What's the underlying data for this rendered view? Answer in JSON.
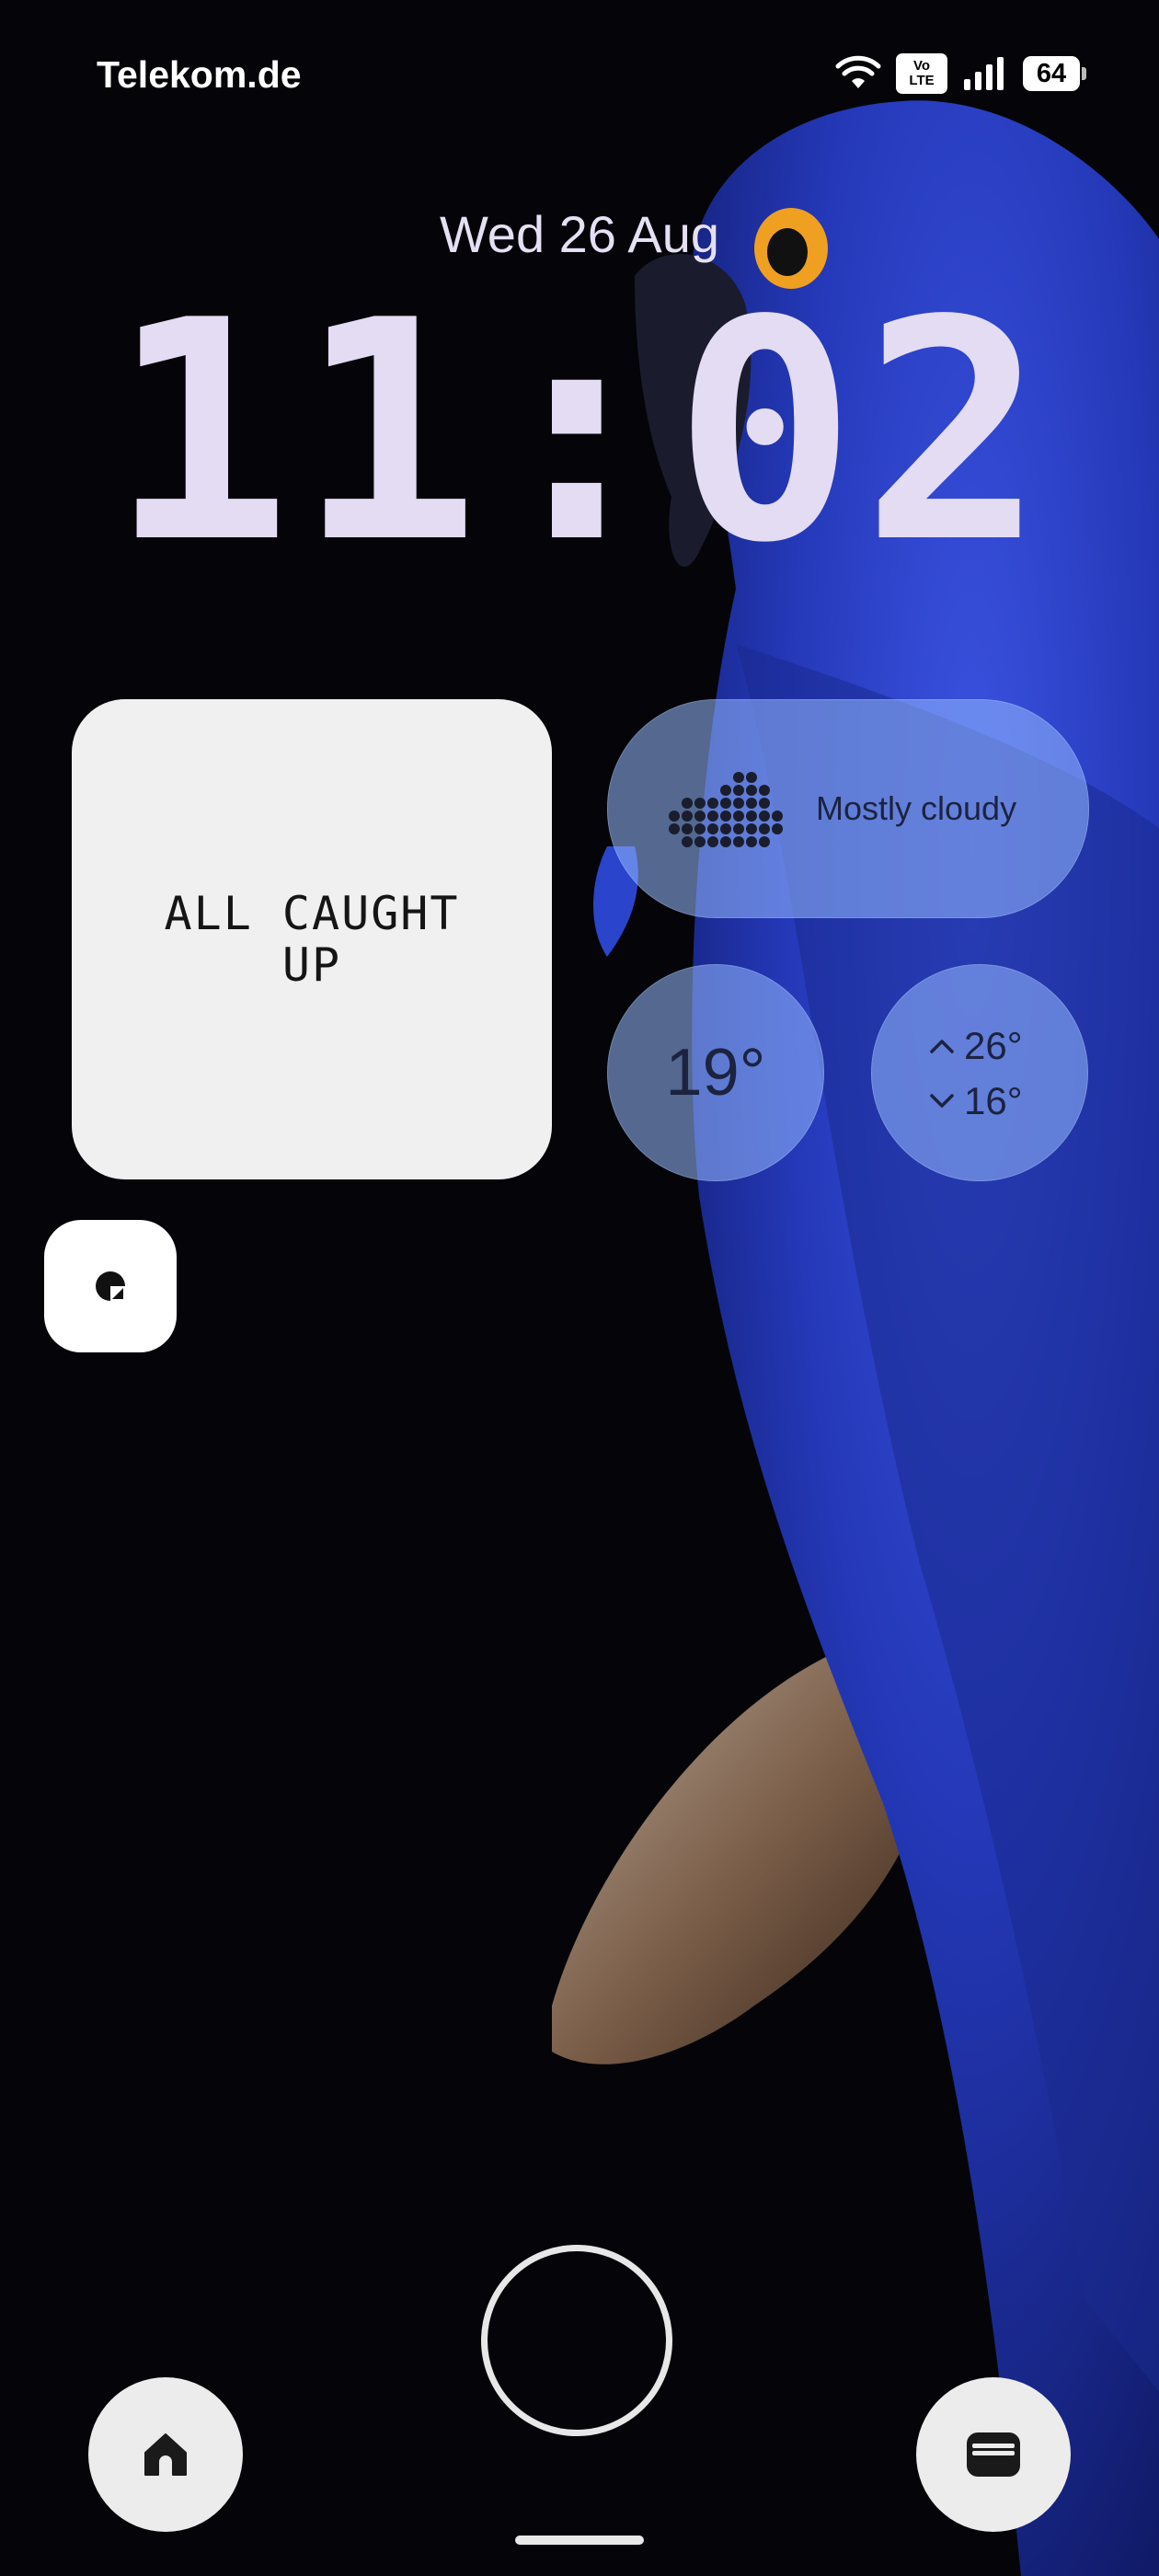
{
  "status_bar": {
    "carrier": "Telekom.de",
    "volte_line1": "Vo",
    "volte_line2": "LTE",
    "battery_level": "64",
    "icons": [
      "wifi-icon",
      "volte-icon",
      "signal-icon",
      "battery-icon"
    ]
  },
  "lockscreen": {
    "date": "Wed 26 Aug",
    "time": "11:02"
  },
  "notifications_widget": {
    "text": "ALL CAUGHT\nUP"
  },
  "weather": {
    "condition": "Mostly cloudy",
    "condition_icon": "cloud-icon",
    "current_temp": "19°",
    "high": "26°",
    "low": "16°"
  },
  "shortcuts": {
    "left_icon": "home-icon",
    "right_icon": "wallet-icon",
    "center_icon": "fingerprint-icon",
    "mini_widget_icon": "app-icon"
  },
  "colors": {
    "background": "#050509",
    "clock": "#e3dcf3",
    "parrot_blue": "#2a3fc0",
    "frost": "#96b9ff",
    "widget_white": "#f0f0f0"
  }
}
